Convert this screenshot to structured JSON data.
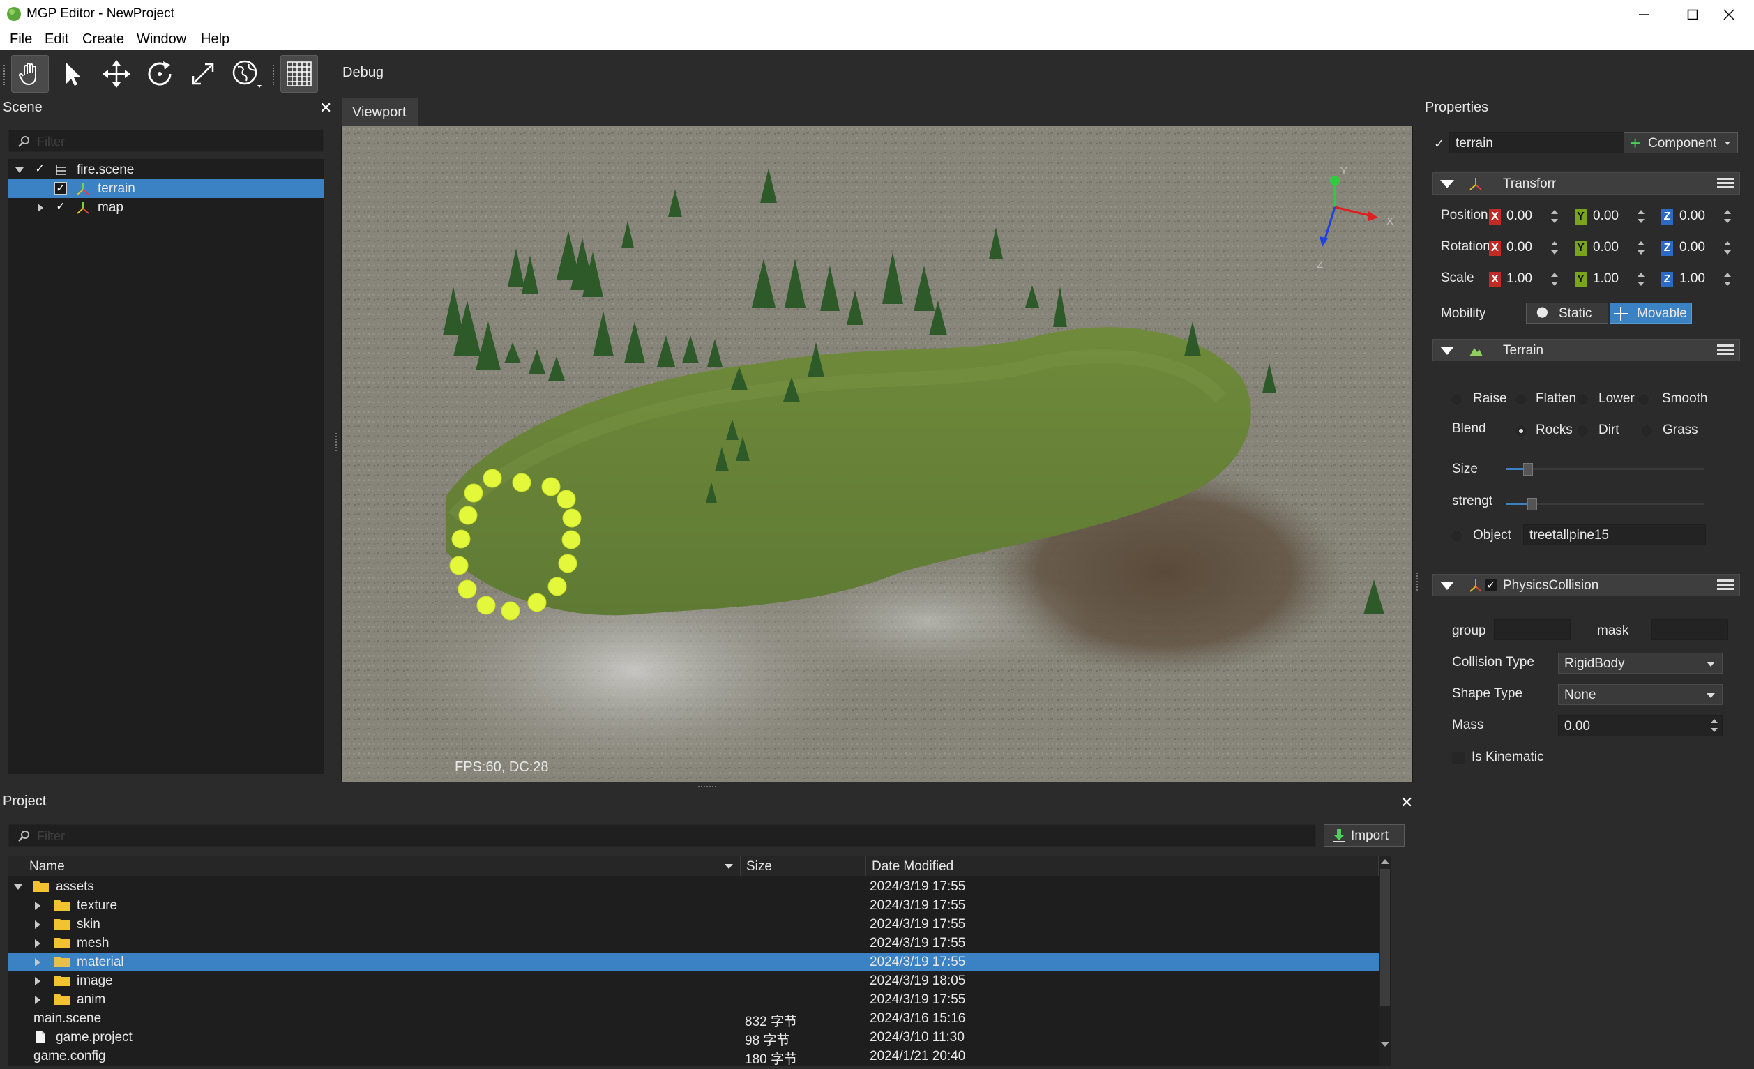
{
  "window": {
    "title": "MGP Editor - NewProject"
  },
  "menu": [
    "File",
    "Edit",
    "Create",
    "Window",
    "Help"
  ],
  "toolbar": {
    "debug_label": "Debug"
  },
  "scene": {
    "title": "Scene",
    "filter_placeholder": "Filter",
    "items": [
      {
        "label": "fire.scene"
      },
      {
        "label": "terrain"
      },
      {
        "label": "map"
      }
    ]
  },
  "viewport": {
    "tab": "Viewport",
    "fps_text": "FPS:60, DC:28",
    "gizmo": {
      "y": "Y",
      "x": "X",
      "z": "Z"
    }
  },
  "properties": {
    "title": "Properties",
    "object_name": "terrain",
    "component_button": "Component",
    "transform": {
      "title": "Transforr",
      "position_label": "Position",
      "rotation_label": "Rotation",
      "scale_label": "Scale",
      "position": [
        "0.00",
        "0.00",
        "0.00"
      ],
      "rotation": [
        "0.00",
        "0.00",
        "0.00"
      ],
      "scale": [
        "1.00",
        "1.00",
        "1.00"
      ],
      "axes": [
        "X",
        "Y",
        "Z"
      ],
      "mobility_label": "Mobility",
      "static_label": "Static",
      "movable_label": "Movable"
    },
    "terrain": {
      "title": "Terrain",
      "modes": [
        "Raise",
        "Flatten",
        "Lower",
        "Smooth"
      ],
      "blend_label": "Blend",
      "blend": [
        "Rocks",
        "Dirt",
        "Grass"
      ],
      "size_label": "Size",
      "size_value": 0.1,
      "strength_label": "strengt",
      "strength_value": 0.12,
      "object_label": "Object",
      "object_value": "treetallpine15"
    },
    "physics": {
      "title": "PhysicsCollision",
      "group_label": "group",
      "mask_label": "mask",
      "collision_type_label": "Collision Type",
      "collision_type": "RigidBody",
      "shape_type_label": "Shape Type",
      "shape_type": "None",
      "mass_label": "Mass",
      "mass": "0.00",
      "kinematic_label": "Is Kinematic"
    }
  },
  "project": {
    "title": "Project",
    "filter_placeholder": "Filter",
    "import_button": "Import",
    "columns": [
      "Name",
      "Size",
      "Date Modified"
    ],
    "rows": [
      {
        "name": "assets",
        "size": "",
        "date": "2024/3/19 17:55"
      },
      {
        "name": "texture",
        "size": "",
        "date": "2024/3/19 17:55"
      },
      {
        "name": "skin",
        "size": "",
        "date": "2024/3/19 17:55"
      },
      {
        "name": "mesh",
        "size": "",
        "date": "2024/3/19 17:55"
      },
      {
        "name": "material",
        "size": "",
        "date": "2024/3/19 17:55"
      },
      {
        "name": "image",
        "size": "",
        "date": "2024/3/19 18:05"
      },
      {
        "name": "anim",
        "size": "",
        "date": "2024/3/19 17:55"
      },
      {
        "name": "main.scene",
        "size": "832 字节",
        "date": "2024/3/16 15:16"
      },
      {
        "name": "game.project",
        "size": "98 字节",
        "date": "2024/3/10 11:30"
      },
      {
        "name": "game.config",
        "size": "180 字节",
        "date": "2024/1/21 20:40"
      }
    ]
  },
  "colors": {
    "accent": "#3a82c4",
    "panel_bg": "#2b2b2b",
    "tree_bg": "#1e1e1e"
  }
}
